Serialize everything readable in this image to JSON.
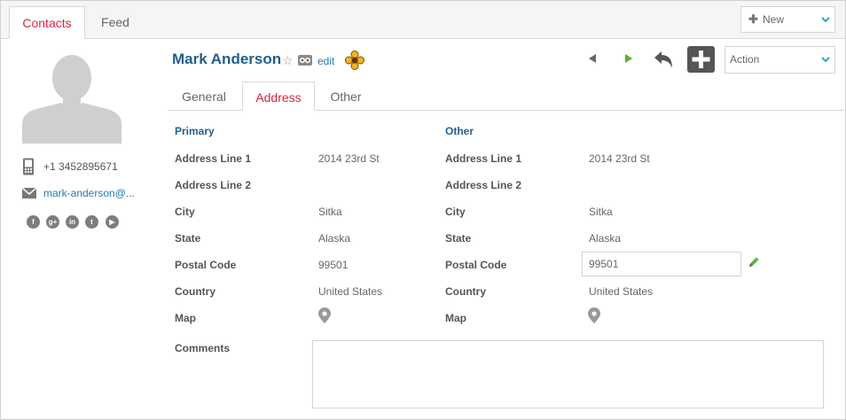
{
  "top_tabs": [
    {
      "label": "Contacts",
      "active": true
    },
    {
      "label": "Feed",
      "active": false
    }
  ],
  "new_button": {
    "label": "New"
  },
  "contact": {
    "name": "Mark Anderson",
    "edit_label": "edit",
    "phone": "+1 3452895671",
    "email": "mark-anderson@...",
    "socials": [
      "facebook-icon",
      "google-plus-icon",
      "linkedin-icon",
      "twitter-icon",
      "youtube-icon"
    ]
  },
  "toolbar": {
    "action_label": "Action"
  },
  "sub_tabs": [
    {
      "label": "General",
      "active": false
    },
    {
      "label": "Address",
      "active": true
    },
    {
      "label": "Other",
      "active": false
    }
  ],
  "address": {
    "primary": {
      "heading": "Primary",
      "fields": [
        {
          "label": "Address Line 1",
          "value": "2014 23rd St"
        },
        {
          "label": "Address Line 2",
          "value": ""
        },
        {
          "label": "City",
          "value": "Sitka"
        },
        {
          "label": "State",
          "value": "Alaska"
        },
        {
          "label": "Postal Code",
          "value": "99501"
        },
        {
          "label": "Country",
          "value": "United States"
        },
        {
          "label": "Map",
          "value": ""
        }
      ]
    },
    "other": {
      "heading": "Other",
      "fields": [
        {
          "label": "Address Line 1",
          "value": "2014 23rd St"
        },
        {
          "label": "Address Line 2",
          "value": ""
        },
        {
          "label": "City",
          "value": "Sitka"
        },
        {
          "label": "State",
          "value": "Alaska"
        },
        {
          "label": "Postal Code",
          "value": "99501"
        },
        {
          "label": "Country",
          "value": "United States"
        },
        {
          "label": "Map",
          "value": ""
        }
      ]
    },
    "comments_label": "Comments",
    "comments_value": ""
  },
  "colors": {
    "accent_red": "#d9263f",
    "link_blue": "#2a7ab0",
    "heading_blue": "#1f5f8f",
    "next_green": "#5ab031"
  }
}
